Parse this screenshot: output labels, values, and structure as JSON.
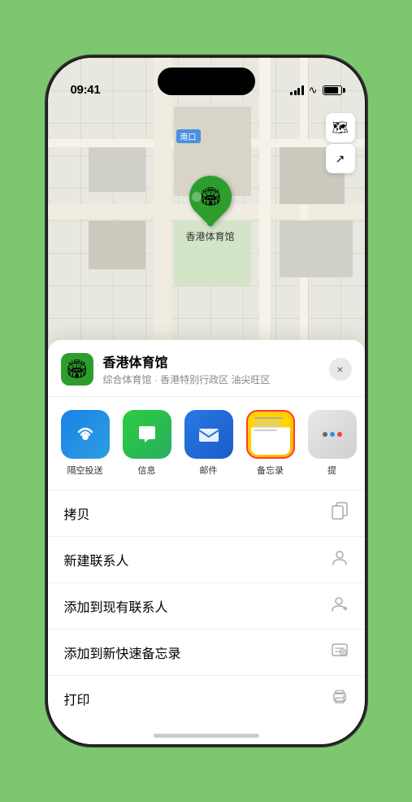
{
  "status_bar": {
    "time": "09:41",
    "location_arrow": "▲"
  },
  "map": {
    "south_entrance_label": "南口",
    "south_entrance_prefix": "南口",
    "venue_name_on_map": "香港体育馆",
    "map_btn_layers": "🗺",
    "map_btn_location": "⬆"
  },
  "sheet": {
    "venue_icon": "🏟",
    "venue_name": "香港体育馆",
    "venue_subtitle": "综合体育馆 · 香港特别行政区 油尖旺区",
    "close_label": "×"
  },
  "actions": [
    {
      "id": "airdrop",
      "label": "隔空投送",
      "type": "airdrop"
    },
    {
      "id": "message",
      "label": "信息",
      "type": "message"
    },
    {
      "id": "mail",
      "label": "邮件",
      "type": "mail"
    },
    {
      "id": "notes",
      "label": "备忘录",
      "type": "notes"
    },
    {
      "id": "more",
      "label": "提",
      "type": "more"
    }
  ],
  "list_items": [
    {
      "id": "copy",
      "label": "拷贝",
      "icon": "copy"
    },
    {
      "id": "new-contact",
      "label": "新建联系人",
      "icon": "person"
    },
    {
      "id": "add-contact",
      "label": "添加到现有联系人",
      "icon": "person-add"
    },
    {
      "id": "quick-note",
      "label": "添加到新快速备忘录",
      "icon": "note"
    },
    {
      "id": "print",
      "label": "打印",
      "icon": "printer"
    }
  ]
}
